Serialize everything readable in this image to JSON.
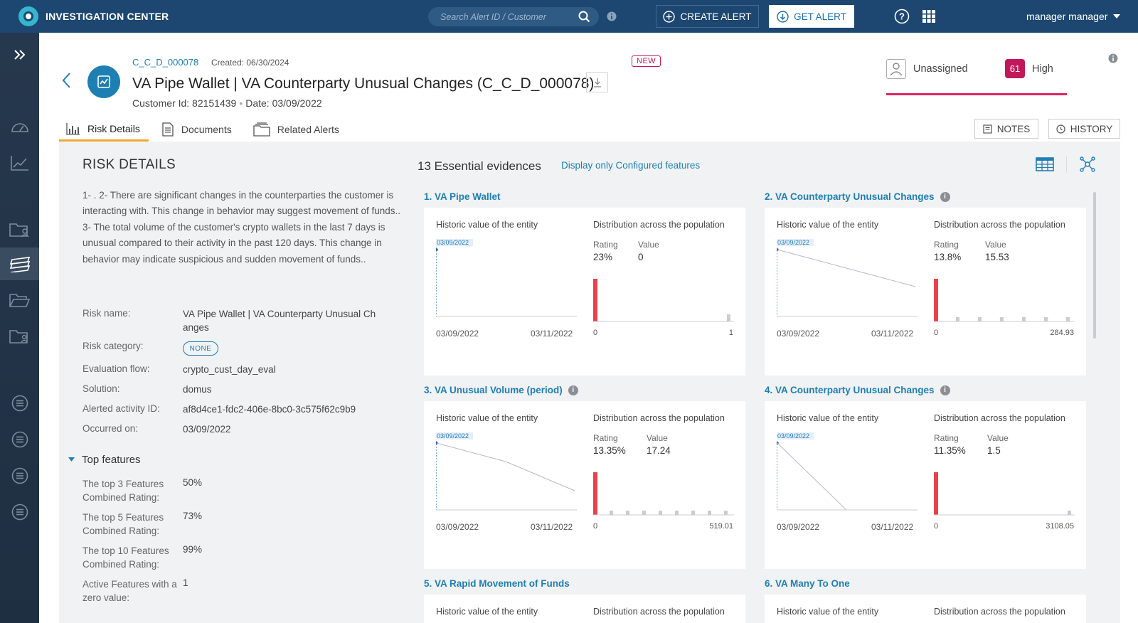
{
  "app": {
    "title": "INVESTIGATION CENTER"
  },
  "search": {
    "placeholder": "Search Alert ID / Customer"
  },
  "header_actions": {
    "create_alert": "CREATE ALERT",
    "get_alert": "GET ALERT",
    "user": "manager manager"
  },
  "alert": {
    "id": "C_C_D_000078",
    "created": "Created: 06/30/2024",
    "badge": "NEW",
    "title": "VA Pipe Wallet | VA Counterparty Unusual Changes (C_C_D_000078)",
    "customer_id": "Customer Id: 82151439",
    "date": "Date: 03/09/2022",
    "assignee": "Unassigned",
    "score": "61",
    "severity": "High"
  },
  "tabs": [
    {
      "label": "Risk Details"
    },
    {
      "label": "Documents"
    },
    {
      "label": "Related Alerts"
    }
  ],
  "buttons": {
    "notes": "NOTES",
    "history": "HISTORY"
  },
  "risk": {
    "heading": "RISK DETAILS",
    "description": "1- . 2- There are significant changes in the counterparties the customer is interacting with. This change in behavior may suggest movement of funds.. 3- The total volume of the customer's crypto wallets in the last 7 days is unusual compared to their activity in the past 120 days. This change in behavior may indicate suspicious and sudden movement of funds..",
    "fields": [
      {
        "label": "Risk name:",
        "value": "VA Pipe Wallet | VA Counterparty Unusual Ch anges"
      },
      {
        "label": "Risk category:",
        "value": "NONE"
      },
      {
        "label": "Evaluation flow:",
        "value": "crypto_cust_day_eval"
      },
      {
        "label": "Solution:",
        "value": "domus"
      },
      {
        "label": "Alerted activity ID:",
        "value": "af8d4ce1-fdc2-406e-8bc0-3c575f62c9b9"
      },
      {
        "label": "Occurred on:",
        "value": "03/09/2022"
      }
    ],
    "top_features_heading": "Top features",
    "top_features": [
      {
        "label": "The top 3 Features Combined Rating:",
        "value": "50%"
      },
      {
        "label": "The top 5 Features Combined Rating:",
        "value": "73%"
      },
      {
        "label": "The top 10 Features Combined Rating:",
        "value": "99%"
      },
      {
        "label": "Active Features with a zero value:",
        "value": "1"
      }
    ]
  },
  "evidences": {
    "heading": "13 Essential evidences",
    "filter_link": "Display only Configured features",
    "common": {
      "historic": "Historic value of the entity",
      "distribution": "Distribution across the population",
      "rating_label": "Rating",
      "value_label": "Value",
      "x_start": "03/09/2022",
      "x_end": "03/11/2022",
      "point_label": "03/09/2022"
    },
    "features": [
      {
        "name": "1. VA Pipe Wallet",
        "rating": "23%",
        "value": "0",
        "d_start": "0",
        "d_end": "1"
      },
      {
        "name": "2. VA Counterparty Unusual Changes",
        "rating": "13.8%",
        "value": "15.53",
        "d_start": "0",
        "d_end": "284.93"
      },
      {
        "name": "3. VA Unusual Volume (period)",
        "rating": "13.35%",
        "value": "17.24",
        "d_start": "0",
        "d_end": "519.01"
      },
      {
        "name": "4. VA Counterparty Unusual Changes",
        "rating": "11.35%",
        "value": "1.5",
        "d_start": "0",
        "d_end": "3108.05"
      },
      {
        "name": "5. VA Rapid Movement of Funds"
      },
      {
        "name": "6. VA Many To One"
      }
    ]
  },
  "colors": {
    "topbar": "#1d4770",
    "accent": "#1e7fb3",
    "severity": "#c2185b",
    "bar": "#e8424b"
  }
}
